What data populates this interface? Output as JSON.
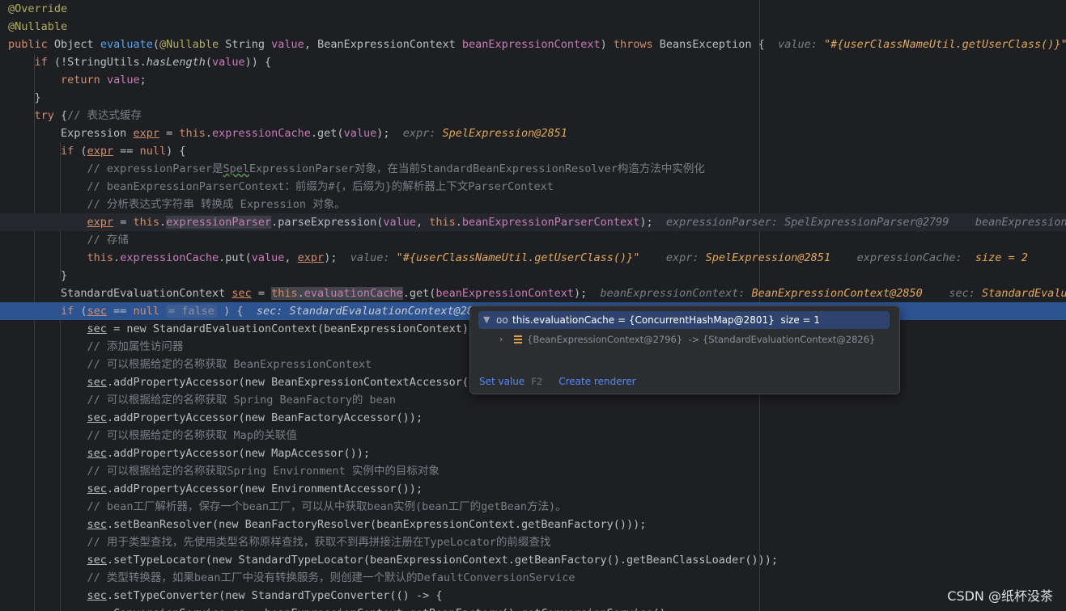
{
  "lines": [
    {
      "segs": [
        [
          "ann",
          "@Override"
        ]
      ]
    },
    {
      "segs": [
        [
          "ann",
          "@Nullable"
        ]
      ]
    },
    {
      "segs": [
        [
          "kw",
          "public "
        ],
        [
          "t",
          "Object "
        ],
        [
          "fn",
          "evaluate"
        ],
        [
          "t",
          "("
        ],
        [
          "ann",
          "@Nullable "
        ],
        [
          "t",
          "String "
        ],
        [
          "par",
          "value"
        ],
        [
          "t",
          ", BeanExpressionContext "
        ],
        [
          "par",
          "beanExpressionContext"
        ],
        [
          "t",
          ") "
        ],
        [
          "kw",
          "throws "
        ],
        [
          "t",
          "BeansException {  "
        ],
        [
          "hint-k",
          "value: "
        ],
        [
          "hint-v",
          "\"#{userClassNameUtil.getUserClass()}\""
        ]
      ]
    },
    {
      "segs": [
        [
          "t",
          "    "
        ],
        [
          "kw",
          "if "
        ],
        [
          "t",
          "(!StringUtils."
        ],
        [
          "static",
          "hasLength"
        ],
        [
          "t",
          "("
        ],
        [
          "par",
          "value"
        ],
        [
          "t",
          ")) {"
        ]
      ]
    },
    {
      "segs": [
        [
          "t",
          "        "
        ],
        [
          "kw",
          "return "
        ],
        [
          "par",
          "value"
        ],
        [
          "t",
          ";"
        ]
      ]
    },
    {
      "segs": [
        [
          "t",
          "    }"
        ]
      ]
    },
    {
      "segs": [
        [
          "t",
          "    "
        ],
        [
          "kw",
          "try "
        ],
        [
          "t",
          "{"
        ],
        [
          "cmt",
          "// 表达式缓存"
        ]
      ]
    },
    {
      "segs": [
        [
          "t",
          "        Expression "
        ],
        [
          "redvar",
          "expr"
        ],
        [
          "t",
          " = "
        ],
        [
          "kw",
          "this"
        ],
        [
          "t",
          "."
        ],
        [
          "fld",
          "expressionCache"
        ],
        [
          "t",
          ".get("
        ],
        [
          "par",
          "value"
        ],
        [
          "t",
          ");  "
        ],
        [
          "hint-k",
          "expr: "
        ],
        [
          "hint-v",
          "SpelExpression@2851"
        ]
      ]
    },
    {
      "segs": [
        [
          "t",
          "        "
        ],
        [
          "kw",
          "if "
        ],
        [
          "t",
          "("
        ],
        [
          "redvar",
          "expr"
        ],
        [
          "t",
          " == "
        ],
        [
          "kw",
          "null"
        ],
        [
          "t",
          ") {"
        ]
      ]
    },
    {
      "segs": [
        [
          "t",
          "            "
        ],
        [
          "cmt",
          "// expressionParser是"
        ],
        [
          "cmt sq",
          "Spel"
        ],
        [
          "cmt",
          "ExpressionParser对象，在当前StandardBeanExpressionResolver构造方法中实例化"
        ]
      ]
    },
    {
      "segs": [
        [
          "t",
          "            "
        ],
        [
          "cmt",
          "// beanExpressionParserContext：前缀为#{，后缀为}的解析器上下文ParserContext"
        ]
      ]
    },
    {
      "segs": [
        [
          "t",
          "            "
        ],
        [
          "cmt",
          "// 分析表达式字符串 转换成 Expression 对象。"
        ]
      ]
    },
    {
      "segs": [
        [
          "t",
          "            "
        ],
        [
          "redvar",
          "expr"
        ],
        [
          "t",
          " = "
        ],
        [
          "kw",
          "this"
        ],
        [
          "t",
          "."
        ],
        [
          "fld hibox",
          "expressionParser"
        ],
        [
          "t",
          "."
        ],
        [
          "t",
          "parseExpression("
        ],
        [
          "par",
          "value"
        ],
        [
          "t",
          ", "
        ],
        [
          "kw",
          "this"
        ],
        [
          "t",
          "."
        ],
        [
          "fld",
          "beanExpressionParserContext"
        ],
        [
          "t",
          ");  "
        ],
        [
          "hint-k",
          "expressionParser: SpelExpressionParser@2799    beanExpressionPa"
        ]
      ],
      "hl": "soft"
    },
    {
      "segs": [
        [
          "t",
          "            "
        ],
        [
          "cmt",
          "// 存储"
        ]
      ]
    },
    {
      "segs": [
        [
          "t",
          "            "
        ],
        [
          "kw",
          "this"
        ],
        [
          "t",
          "."
        ],
        [
          "fld",
          "expressionCache"
        ],
        [
          "t",
          ".put("
        ],
        [
          "par",
          "value"
        ],
        [
          "t",
          ", "
        ],
        [
          "redvar",
          "expr"
        ],
        [
          "t",
          ");  "
        ],
        [
          "hint-k",
          "value: "
        ],
        [
          "hint-v",
          "\"#{userClassNameUtil.getUserClass()}\"    "
        ],
        [
          "hint-k",
          "expr: "
        ],
        [
          "hint-v",
          "SpelExpression@2851    "
        ],
        [
          "hint-k",
          "expressionCache:  "
        ],
        [
          "hint-v",
          "size = 2"
        ]
      ]
    },
    {
      "segs": [
        [
          "t",
          "        }"
        ]
      ]
    },
    {
      "segs": [
        [
          "t",
          "        StandardEvaluationContext "
        ],
        [
          "redvar",
          "sec"
        ],
        [
          "t",
          " = "
        ],
        [
          "kw hibox2",
          "this"
        ],
        [
          "t hibox2",
          "."
        ],
        [
          "fld hibox2",
          "evaluationCache"
        ],
        [
          "t",
          ".get("
        ],
        [
          "par",
          "beanExpressionContext"
        ],
        [
          "t",
          ");  "
        ],
        [
          "hint-k",
          "beanExpressionContext: "
        ],
        [
          "hint-v",
          "BeanExpressionContext@2850    "
        ],
        [
          "hint-k",
          "sec: "
        ],
        [
          "hint-v",
          "StandardEvaluat"
        ]
      ]
    },
    {
      "segs": [
        [
          "t",
          "        "
        ],
        [
          "kw",
          "if "
        ],
        [
          "t",
          "("
        ],
        [
          "redvar",
          "sec"
        ],
        [
          "t",
          " == "
        ],
        [
          "kw",
          "null"
        ],
        [
          "t",
          " "
        ],
        [
          "inline-bool",
          "= false"
        ],
        [
          "t",
          " ) {  "
        ],
        [
          "hint-vw",
          "sec: StandardEvaluationContext@2826 ⌄"
        ]
      ],
      "hl": "exec"
    },
    {
      "segs": [
        [
          "t",
          "            "
        ],
        [
          "uvar",
          "sec"
        ],
        [
          "t",
          " = new StandardEvaluationContext(beanExpressionContext);"
        ]
      ]
    },
    {
      "segs": [
        [
          "t",
          "            "
        ],
        [
          "cmt",
          "// 添加属性访问器"
        ]
      ]
    },
    {
      "segs": [
        [
          "t",
          "            "
        ],
        [
          "cmt",
          "// 可以根据给定的名称获取 BeanExpressionContext"
        ]
      ]
    },
    {
      "segs": [
        [
          "t",
          "            "
        ],
        [
          "uvar",
          "sec"
        ],
        [
          "t",
          ".addPropertyAccessor(new BeanExpressionContextAccessor());"
        ]
      ]
    },
    {
      "segs": [
        [
          "t",
          "            "
        ],
        [
          "cmt",
          "// 可以根据给定的名称获取 Spring BeanFactory的 bean"
        ]
      ]
    },
    {
      "segs": [
        [
          "t",
          "            "
        ],
        [
          "uvar",
          "sec"
        ],
        [
          "t",
          ".addPropertyAccessor(new BeanFactoryAccessor());"
        ]
      ]
    },
    {
      "segs": [
        [
          "t",
          "            "
        ],
        [
          "cmt",
          "// 可以根据给定的名称获取 Map的关联值"
        ]
      ]
    },
    {
      "segs": [
        [
          "t",
          "            "
        ],
        [
          "uvar",
          "sec"
        ],
        [
          "t",
          ".addPropertyAccessor(new MapAccessor());"
        ]
      ]
    },
    {
      "segs": [
        [
          "t",
          "            "
        ],
        [
          "cmt",
          "// 可以根据给定的名称获取Spring Environment 实例中的目标对象"
        ]
      ]
    },
    {
      "segs": [
        [
          "t",
          "            "
        ],
        [
          "uvar",
          "sec"
        ],
        [
          "t",
          ".addPropertyAccessor(new EnvironmentAccessor());"
        ]
      ]
    },
    {
      "segs": [
        [
          "t",
          "            "
        ],
        [
          "cmt",
          "// bean工厂解析器，保存一个bean工厂，可以从中获取bean实例(bean工厂的getBean方法)。"
        ]
      ]
    },
    {
      "segs": [
        [
          "t",
          "            "
        ],
        [
          "uvar",
          "sec"
        ],
        [
          "t",
          ".setBeanResolver(new BeanFactoryResolver(beanExpressionContext.getBeanFactory()));"
        ]
      ]
    },
    {
      "segs": [
        [
          "t",
          "            "
        ],
        [
          "cmt",
          "// 用于类型查找，先使用类型名称原样查找，获取不到再拼接注册在TypeLocator的前缀查找"
        ]
      ]
    },
    {
      "segs": [
        [
          "t",
          "            "
        ],
        [
          "uvar",
          "sec"
        ],
        [
          "t",
          ".setTypeLocator(new StandardTypeLocator(beanExpressionContext.getBeanFactory().getBeanClassLoader()));"
        ]
      ]
    },
    {
      "segs": [
        [
          "t",
          "            "
        ],
        [
          "cmt",
          "// 类型转换器，如果bean工厂中没有转换服务，则创建一个默认的DefaultConversionService"
        ]
      ]
    },
    {
      "segs": [
        [
          "t",
          "            "
        ],
        [
          "uvar",
          "sec"
        ],
        [
          "t",
          ".setTypeConverter(new StandardTypeConverter(() -> {"
        ]
      ]
    },
    {
      "segs": [
        [
          "t",
          "                ConversionService cs = beanExpressionContext.getBeanFactory().getConversionService();"
        ]
      ]
    }
  ],
  "popup": {
    "title": "this.evaluationCache = {ConcurrentHashMap@2801}  size = 1",
    "entry": "{BeanExpressionContext@2796}  -> {StandardEvaluationContext@2826}",
    "set_value": "Set value",
    "set_value_key": "F2",
    "create_renderer": "Create renderer",
    "expand_icon": "chevron-down-icon",
    "watch_icon": "glasses-icon",
    "entry_icon": "map-entry-icon"
  },
  "watermark": "CSDN @纸杯没茶",
  "colors": {
    "background": "#1e1f22",
    "keyword": "#cf8e6d",
    "annotation": "#b3ae60",
    "method": "#56a8f5",
    "field": "#c77dbb",
    "comment": "#7a7e85",
    "hint_value": "#e0a85a",
    "execution_line": "#2d5491",
    "link": "#548af7"
  }
}
